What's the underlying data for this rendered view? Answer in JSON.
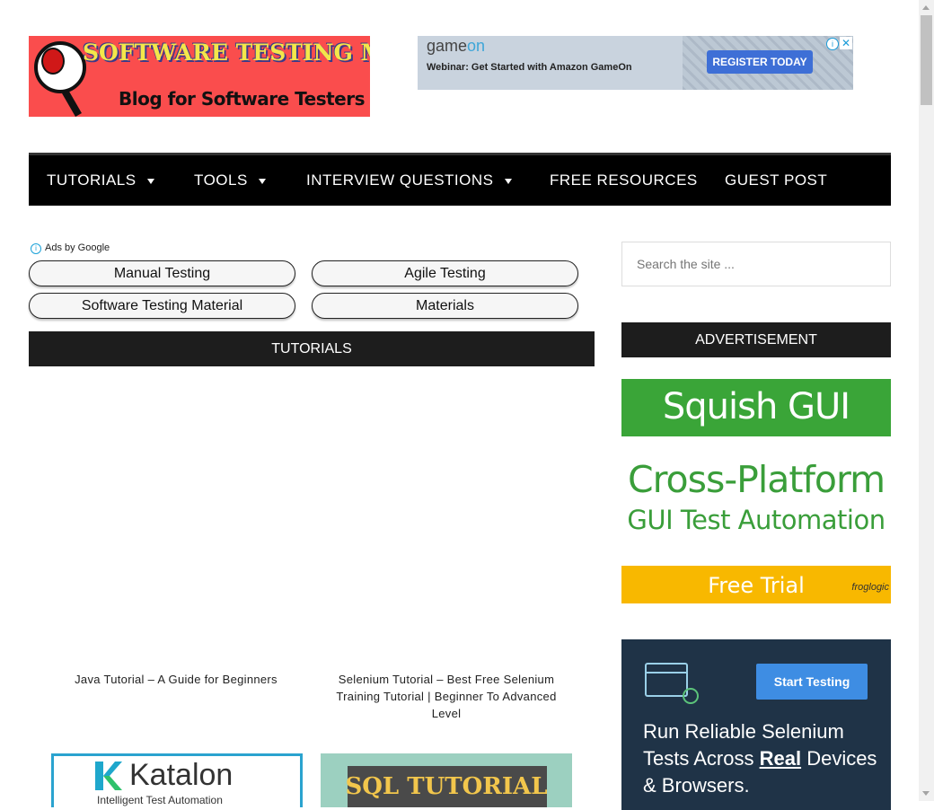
{
  "header": {
    "logo_title": "SOFTWARE TESTING MATERIAL",
    "logo_tagline": "Blog for Software Testers"
  },
  "top_ad": {
    "brand_prefix": "game",
    "brand_suffix": "on",
    "headline": "Webinar: Get Started with Amazon GameOn",
    "cta": "REGISTER TODAY",
    "info_icon": "info-icon",
    "close_icon": "close-icon"
  },
  "nav": {
    "items": [
      {
        "label": "TUTORIALS",
        "has_caret": true
      },
      {
        "label": "TOOLS",
        "has_caret": true
      },
      {
        "label": "INTERVIEW QUESTIONS",
        "has_caret": true
      },
      {
        "label": "FREE RESOURCES",
        "has_caret": false
      },
      {
        "label": "GUEST POST",
        "has_caret": false
      }
    ]
  },
  "ad_links": {
    "label": "Ads by Google",
    "items": [
      "Manual Testing",
      "Agile Testing",
      "Software Testing Material",
      "Materials"
    ]
  },
  "main": {
    "section_title": "TUTORIALS",
    "posts": [
      {
        "title": "Java Tutorial – A Guide for Beginners"
      },
      {
        "title": "Selenium Tutorial – Best Free Selenium Training Tutorial | Beginner To Advanced Level"
      }
    ],
    "thumbs": [
      {
        "brand": "Katalon",
        "sub": "Intelligent Test Automation"
      },
      {
        "text": "SQL TUTORIAL"
      }
    ]
  },
  "sidebar": {
    "search_placeholder": "Search the site ...",
    "ad_heading": "ADVERTISEMENT",
    "squish_ad": {
      "title": "Squish GUI Tester",
      "line1": "Cross-Platform",
      "line2": "GUI Test Automation",
      "cta": "Free Trial",
      "brand": "froglogic"
    },
    "lambda_ad": {
      "cta": "Start Testing",
      "headline_pre": "Run Reliable Selenium Tests Across ",
      "headline_bold": "Real",
      "headline_post": " Devices & Browsers."
    }
  },
  "colors": {
    "nav_bg": "#000000",
    "bar_bg": "#1d1d1d",
    "logo_bg": "#fa4d4d",
    "squish_green": "#3aa538",
    "squish_yellow": "#f8b800",
    "lambda_bg": "#1f3347"
  }
}
